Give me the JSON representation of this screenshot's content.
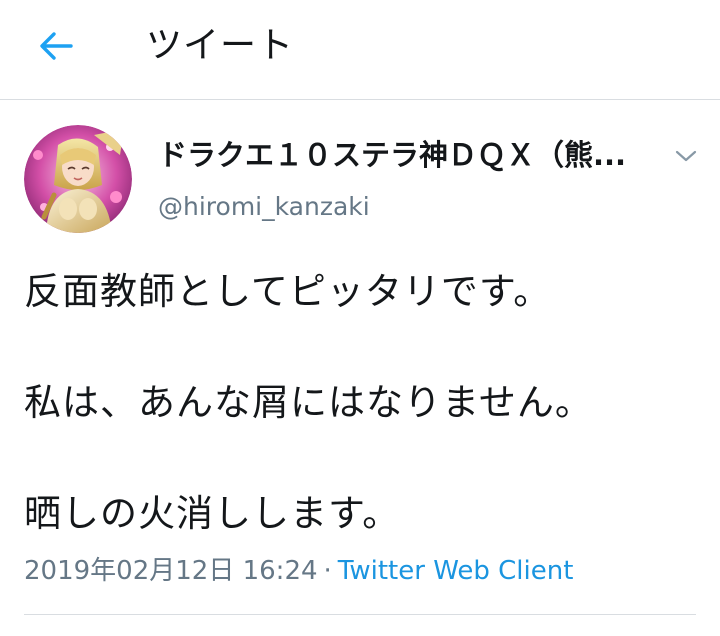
{
  "header": {
    "title": "ツイート",
    "back_icon": "arrow-left-icon",
    "accent_color": "#1da1f2"
  },
  "tweet": {
    "display_name": "ドラクエ１０ステラ神ＤＱＸ（熊...",
    "handle": "@hiromi_kanzaki",
    "menu_icon": "chevron-down-icon",
    "lines": [
      "反面教師としてピッタリです。",
      "私は、あんな屑にはなりません。",
      "晒しの火消しします。"
    ],
    "timestamp": "2019年02月12日 16:24",
    "separator": "·",
    "source": "Twitter Web Client",
    "link_color": "#1b95e0"
  }
}
